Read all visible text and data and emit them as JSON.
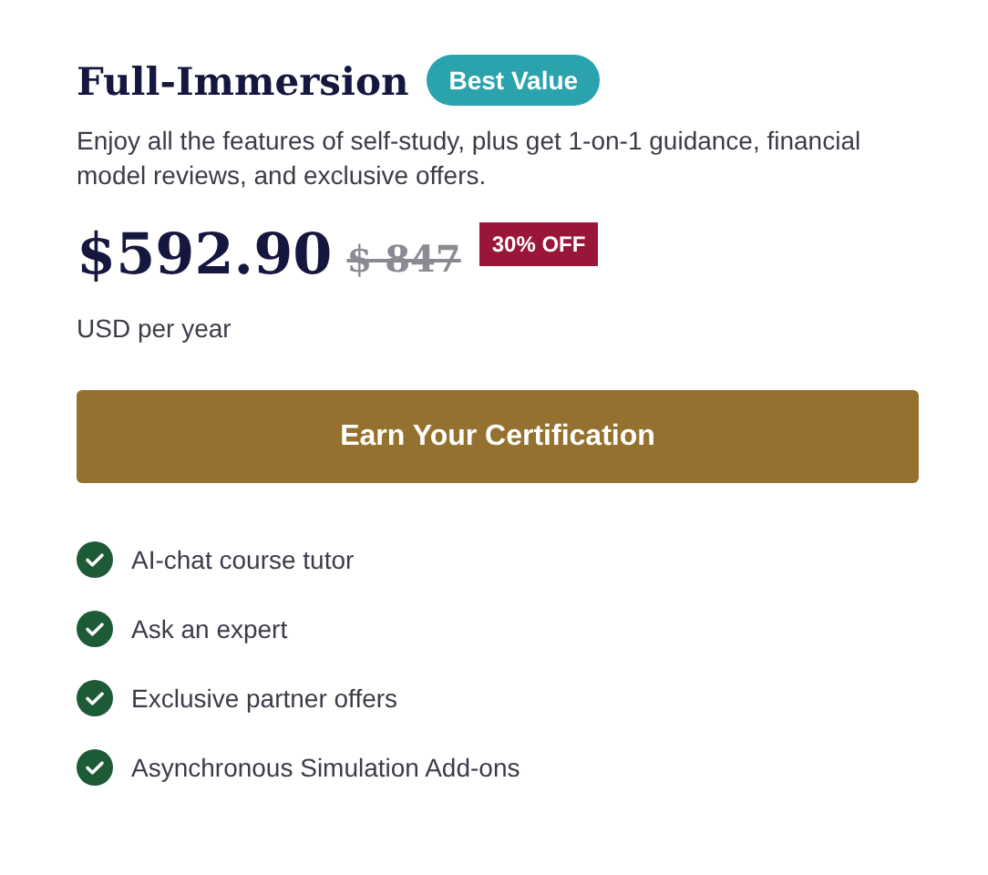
{
  "plan": {
    "title": "Full-Immersion",
    "badge": "Best Value",
    "description": "Enjoy all the features of self-study, plus get 1-on-1 guidance, financial model reviews, and exclusive offers."
  },
  "price": {
    "current": "$592.90",
    "original": "$ 847",
    "discount": "30% OFF",
    "period": "USD per year"
  },
  "cta": {
    "label": "Earn Your Certification"
  },
  "features": [
    {
      "label": "AI-chat course tutor",
      "included": true
    },
    {
      "label": "Ask an expert",
      "included": true
    },
    {
      "label": "Exclusive partner offers",
      "included": true
    },
    {
      "label": "Asynchronous Simulation Add-ons",
      "included": true
    }
  ]
}
